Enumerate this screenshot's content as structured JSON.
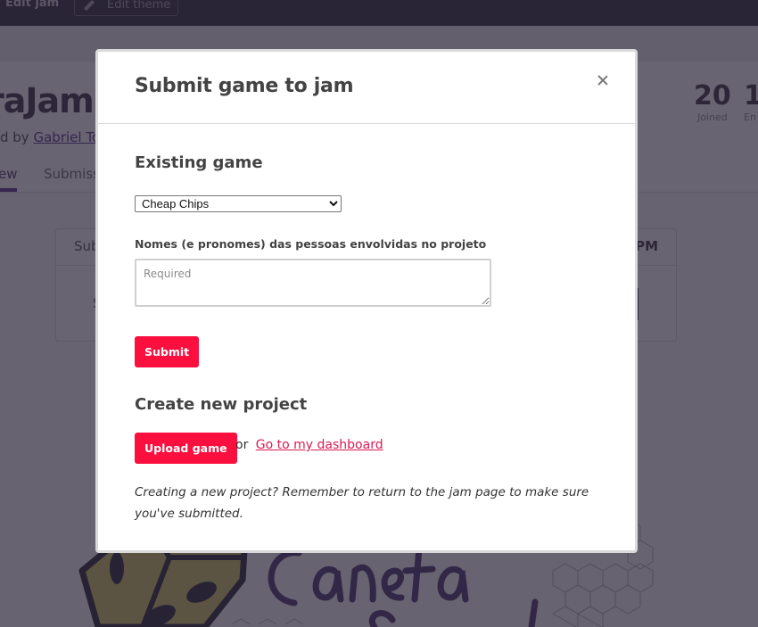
{
  "background": {
    "topbar": {
      "edit_jam_label": "Edit jam",
      "edit_theme_label": "Edit theme"
    },
    "jam": {
      "title_fragment": "raJam",
      "host_prefix": "d by",
      "host_name": "Gabriel Tosc"
    },
    "tabs": [
      {
        "label": "ew",
        "active": true
      },
      {
        "label": "Submiss",
        "active": false
      }
    ],
    "stats": [
      {
        "value": "20",
        "label": "Joined"
      },
      {
        "value": "1",
        "label": "En"
      }
    ],
    "countdown": {
      "left_text": "Sub",
      "right_text": "PM",
      "body_fragment": "S"
    },
    "banner": {
      "text_line1": "Caneta",
      "text_line2": "&Papel",
      "accent_color": "#4a3470",
      "dice_color": "#d6c861"
    }
  },
  "modal": {
    "title": "Submit game to jam",
    "close_icon": "close-icon",
    "existing_game": {
      "heading": "Existing game",
      "selected_game": "Cheap Chips",
      "field_label": "Nomes (e pronomes) das pessoas envolvidas no projeto",
      "field_placeholder": "Required",
      "field_value": "",
      "submit_label": "Submit"
    },
    "create_new": {
      "heading": "Create new project",
      "upload_label": "Upload game",
      "or_text": "or",
      "dashboard_link": "Go to my dashboard",
      "note": "Creating a new project? Remember to return to the jam page to make sure you've submitted."
    }
  },
  "colors": {
    "primary_button": "#fa0f3f",
    "link": "#da1a53",
    "brand_purple": "#5c2d91"
  }
}
